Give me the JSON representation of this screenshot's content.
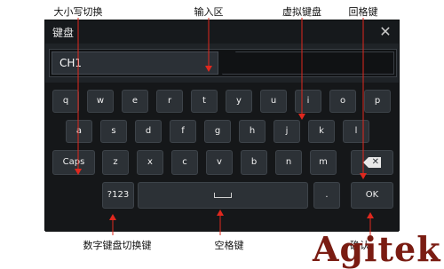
{
  "callouts": {
    "case_switch": "大小写切换",
    "input_area": "输入区",
    "virtual_keyboard": "虚拟键盘",
    "backspace": "回格键",
    "numeric_switch": "数字键盘切换键",
    "space": "空格键",
    "confirm_partial": "确认"
  },
  "window": {
    "title": "键盘",
    "close_glyph": "✕"
  },
  "input": {
    "value": "CH1"
  },
  "keyboard": {
    "row1": [
      "q",
      "w",
      "e",
      "r",
      "t",
      "y",
      "u",
      "i",
      "o",
      "p"
    ],
    "row2": [
      "a",
      "s",
      "d",
      "f",
      "g",
      "h",
      "j",
      "k",
      "l"
    ],
    "row3": [
      "z",
      "x",
      "c",
      "v",
      "b",
      "n",
      "m"
    ],
    "caps_label": "Caps",
    "numeric_label": "?123",
    "dot_label": ".",
    "ok_label": "OK",
    "backspace_icon": "backspace-icon",
    "space_icon": "space-bar-icon"
  },
  "logo": {
    "text": "Agitek"
  },
  "colors": {
    "annotation_line": "#e0281e",
    "logo": "#7a1c12"
  }
}
